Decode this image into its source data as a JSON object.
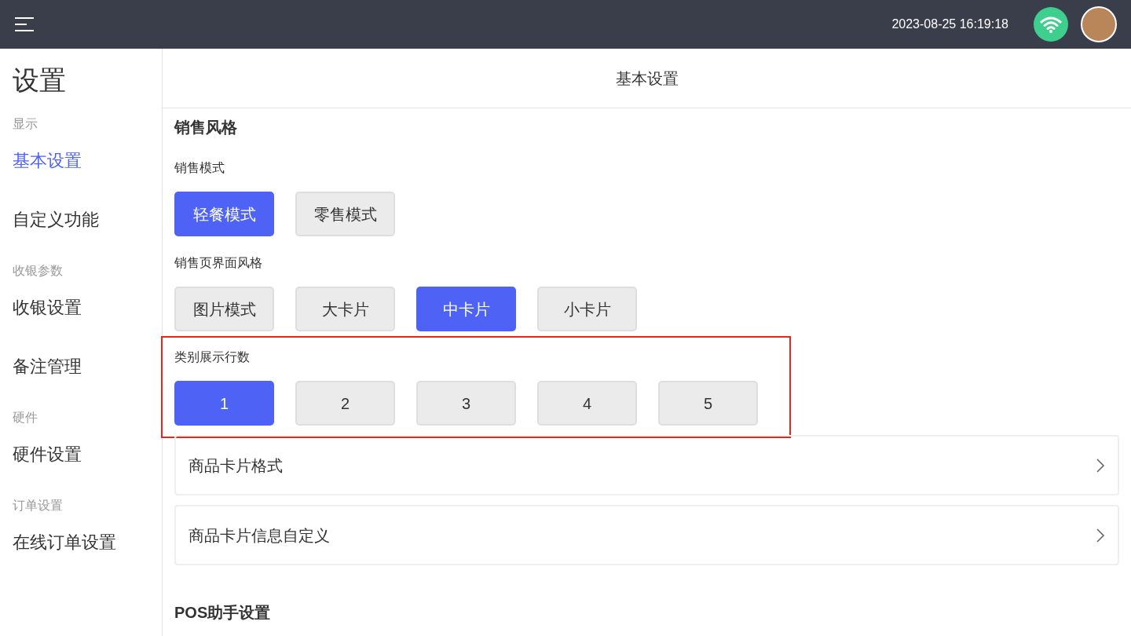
{
  "top_bar": {
    "datetime": "2023-08-25 16:19:18"
  },
  "sidebar": {
    "title": "设置",
    "groups": [
      {
        "label": "显示",
        "items": [
          {
            "label": "基本设置",
            "selected": true
          },
          {
            "label": "自定义功能",
            "selected": false
          }
        ]
      },
      {
        "label": "收银参数",
        "items": [
          {
            "label": "收银设置",
            "selected": false
          },
          {
            "label": "备注管理",
            "selected": false
          }
        ]
      },
      {
        "label": "硬件",
        "items": [
          {
            "label": "硬件设置",
            "selected": false
          }
        ]
      },
      {
        "label": "订单设置",
        "items": [
          {
            "label": "在线订单设置",
            "selected": false
          }
        ]
      }
    ]
  },
  "content": {
    "title": "基本设置",
    "section": "销售风格",
    "option_groups": [
      {
        "label": "销售模式",
        "highlighted": false,
        "options": [
          {
            "label": "轻餐模式",
            "selected": true
          },
          {
            "label": "零售模式",
            "selected": false
          }
        ]
      },
      {
        "label": "销售页界面风格",
        "highlighted": false,
        "options": [
          {
            "label": "图片模式",
            "selected": false
          },
          {
            "label": "大卡片",
            "selected": false
          },
          {
            "label": "中卡片",
            "selected": true
          },
          {
            "label": "小卡片",
            "selected": false
          }
        ]
      },
      {
        "label": "类别展示行数",
        "highlighted": true,
        "options": [
          {
            "label": "1",
            "selected": true
          },
          {
            "label": "2",
            "selected": false
          },
          {
            "label": "3",
            "selected": false
          },
          {
            "label": "4",
            "selected": false
          },
          {
            "label": "5",
            "selected": false
          }
        ]
      }
    ],
    "links": [
      "商品卡片格式",
      "商品卡片信息自定义"
    ],
    "next_section": "POS助手设置"
  }
}
